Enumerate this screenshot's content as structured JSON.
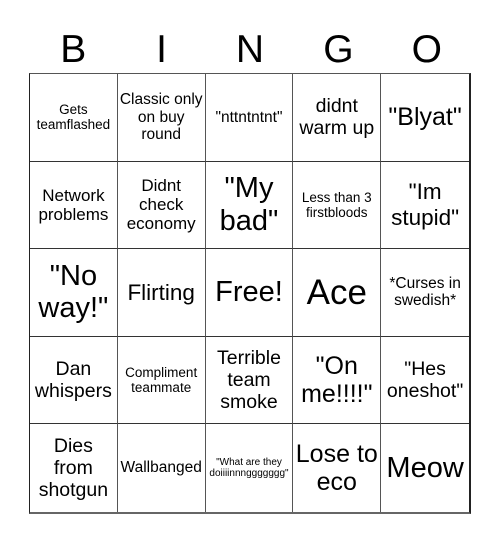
{
  "title_letters": [
    "B",
    "I",
    "N",
    "G",
    "O"
  ],
  "cells": [
    "Gets teamflashed",
    "Classic only on buy round",
    "\"nttntntnt\"",
    "didnt warm up",
    "\"Blyat\"",
    "Network problems",
    "Didnt check economy",
    "\"My bad\"",
    "Less than 3 firstbloods",
    "\"Im stupid\"",
    "\"No way!\"",
    "Flirting",
    "Free!",
    "Ace",
    "*Curses in swedish*",
    "Dan whispers",
    "Compliment teammate",
    "Terrible team smoke",
    "\"On me!!!!\"",
    "\"Hes oneshot\"",
    "Dies from shotgun",
    "Wallbanged",
    "\"What are they doiiiinnnggggggg\"",
    "Lose to eco",
    "Meow"
  ]
}
